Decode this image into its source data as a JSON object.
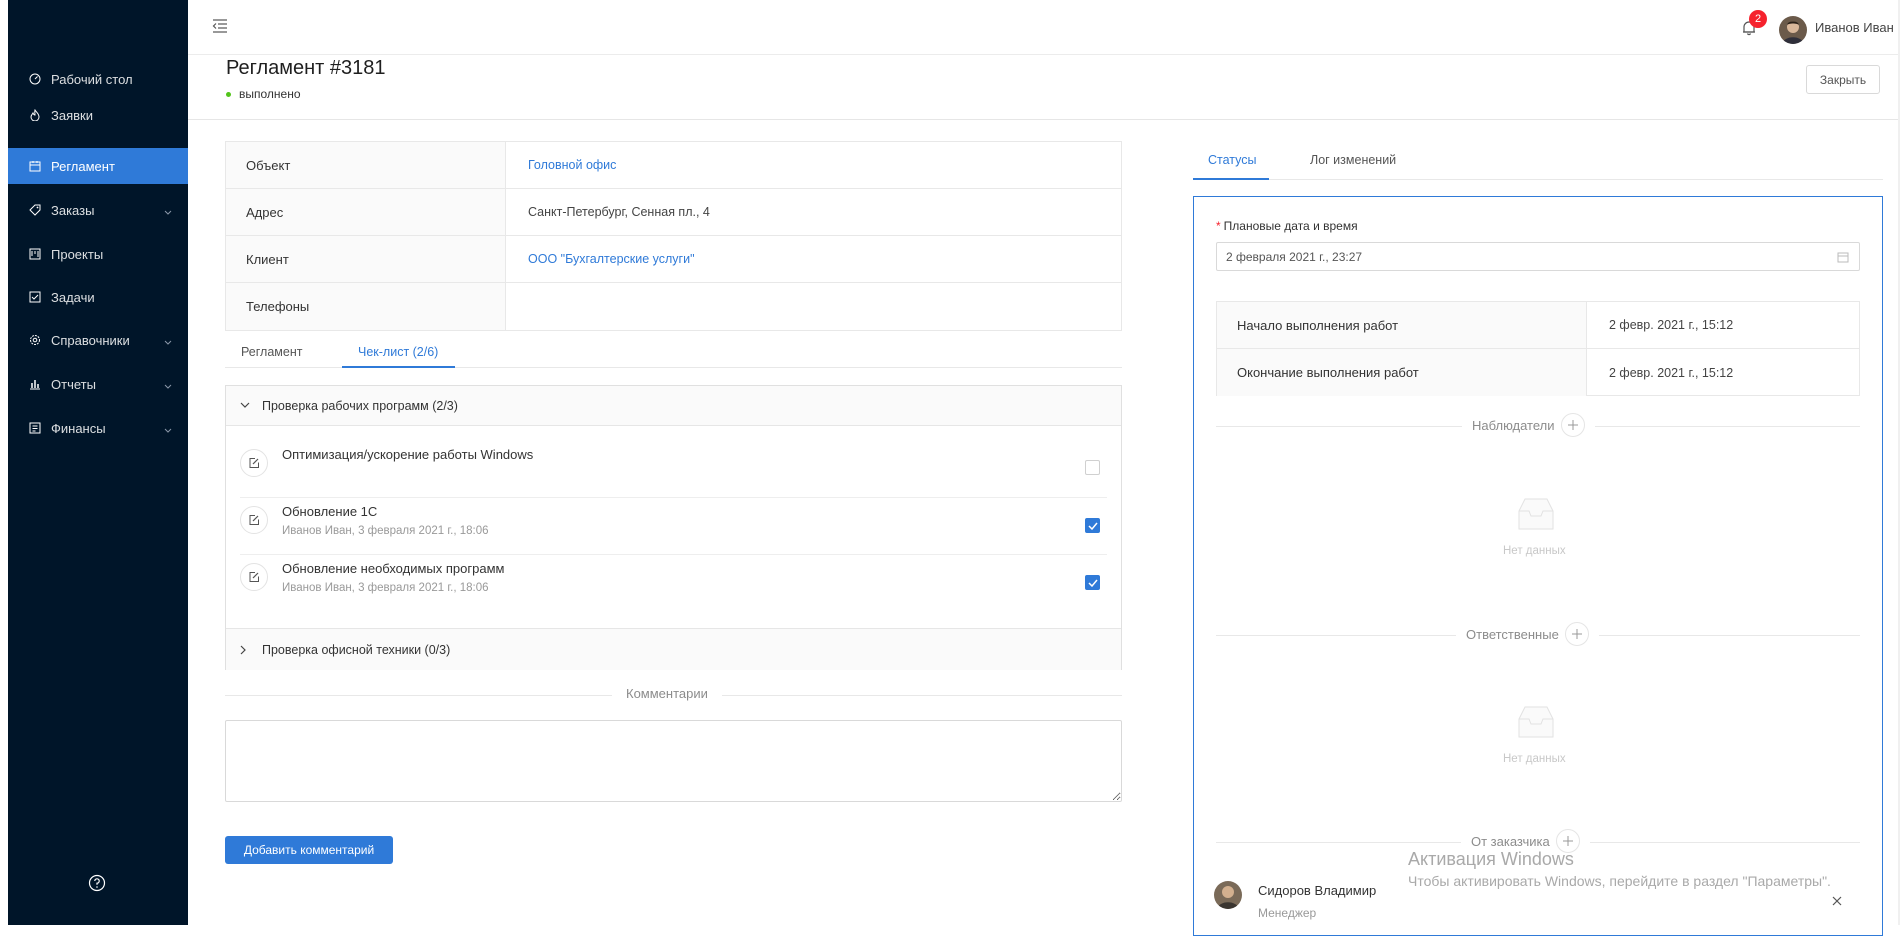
{
  "sidebar": {
    "items": [
      {
        "label": "Рабочий стол",
        "icon": "dashboard-icon"
      },
      {
        "label": "Заявки",
        "icon": "fire-icon"
      },
      {
        "label": "Регламент",
        "icon": "calendar-icon",
        "active": true
      },
      {
        "label": "Заказы",
        "icon": "tag-icon",
        "has_children": true
      },
      {
        "label": "Проекты",
        "icon": "project-icon"
      },
      {
        "label": "Задачи",
        "icon": "checkbox-icon"
      },
      {
        "label": "Справочники",
        "icon": "gear-icon",
        "has_children": true
      },
      {
        "label": "Отчеты",
        "icon": "bar-chart-icon",
        "has_children": true
      },
      {
        "label": "Финансы",
        "icon": "finance-icon",
        "has_children": true
      }
    ],
    "help_icon": "question-circle-icon"
  },
  "header": {
    "menu_toggle_icon": "menu-fold-icon",
    "notification_count": "2",
    "user_name": "Иванов Иван"
  },
  "page": {
    "title": "Регламент #3181",
    "status": "выполнено",
    "close_label": "Закрыть"
  },
  "info": {
    "rows": [
      {
        "label": "Объект",
        "value": "Головной офис",
        "link": true
      },
      {
        "label": "Адрес",
        "value": "Санкт-Петербург, Сенная пл., 4",
        "link": false
      },
      {
        "label": "Клиент",
        "value": "ООО \"Бухгалтерские услуги\"",
        "link": true
      },
      {
        "label": "Телефоны",
        "value": "",
        "link": false
      }
    ]
  },
  "left_tabs": [
    "Регламент",
    "Чек-лист (2/6)"
  ],
  "checklist": {
    "group1": {
      "title": "Проверка рабочих программ (2/3)",
      "items": [
        {
          "title": "Оптимизация/ускорение работы Windows",
          "sub": "",
          "checked": false
        },
        {
          "title": "Обновление 1С",
          "sub": "Иванов Иван, 3 февраля 2021 г., 18:06",
          "checked": true
        },
        {
          "title": "Обновление необходимых программ",
          "sub": "Иванов Иван, 3 февраля 2021 г., 18:06",
          "checked": true
        }
      ]
    },
    "group2": {
      "title": "Проверка офисной техники (0/3)"
    }
  },
  "comments": {
    "divider": "Комментарии",
    "add_label": "Добавить комментарий"
  },
  "right_tabs": [
    "Статусы",
    "Лог изменений"
  ],
  "status_panel": {
    "planned_label": "Плановые дата и время",
    "required_mark": "*",
    "planned_value": "2 февраля 2021 г., 23:27",
    "work_rows": [
      {
        "label": "Начало выполнения работ",
        "value": "2 февр. 2021 г., 15:12"
      },
      {
        "label": "Окончание выполнения работ",
        "value": "2 февр. 2021 г., 15:12"
      }
    ],
    "observers": "Наблюдатели",
    "responsible": "Ответственные",
    "from_customer": "От заказчика",
    "empty_text": "Нет данных",
    "contact": {
      "name": "Сидоров Владимир",
      "role": "Менеджер"
    }
  },
  "watermark": {
    "title": "Активация Windows",
    "text": "Чтобы активировать Windows, перейдите в раздел \"Параметры\"."
  },
  "colors": {
    "accent": "#2f7ad8",
    "sidebar": "#001529",
    "success": "#52c41a",
    "badge": "#f5222d"
  }
}
